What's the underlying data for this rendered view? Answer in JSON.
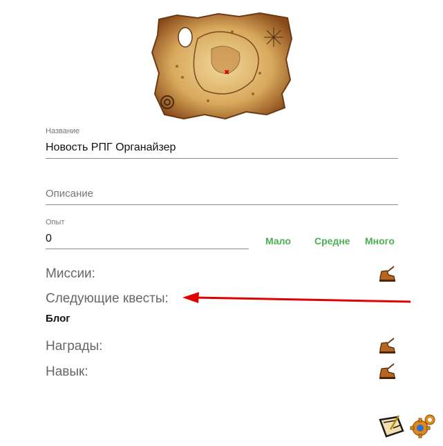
{
  "map": {
    "image_name": "treasure-map"
  },
  "title_field": {
    "label": "Название",
    "value": "Новость РПГ Органайзер"
  },
  "description_field": {
    "placeholder": "Описание",
    "value": ""
  },
  "xp_field": {
    "label": "Опыт",
    "value": "0"
  },
  "xp_buttons": {
    "low": "Мало",
    "mid": "Средне",
    "high": "Много"
  },
  "sections": {
    "missions": "Миссии:",
    "next_quests": "Следующие квесты:",
    "next_quests_item": "Блог",
    "rewards": "Награды:",
    "skill": "Навык:"
  },
  "icons": {
    "mission_add": "edit-boot-icon",
    "reward_add": "edit-boot-icon",
    "skill_add": "edit-boot-icon",
    "save": "scroll-quill-icon",
    "settings": "gears-icon"
  },
  "colors": {
    "accent_green": "#4caf50",
    "arrow_red": "#e00000"
  }
}
